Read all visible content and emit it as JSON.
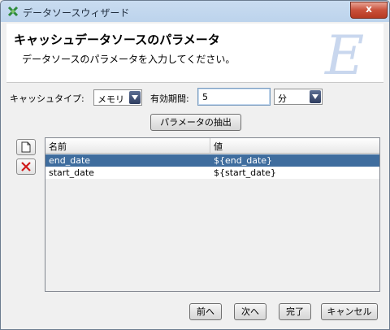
{
  "window": {
    "title": "データソースウィザード",
    "close_glyph": "x"
  },
  "header": {
    "title": "キャッシュデータソースのパラメータ",
    "description": "データソースのパラメータを入力してください。",
    "logo_letter": "E"
  },
  "cache": {
    "type_label": "キャッシュタイプ:",
    "type_value": "メモリ",
    "period_label": "有効期間:",
    "period_value": "5",
    "unit_value": "分"
  },
  "extract_button": "パラメータの抽出",
  "side_buttons": {
    "new_icon": "new-document-icon",
    "delete_icon": "delete-x-icon"
  },
  "table": {
    "columns": [
      "名前",
      "値"
    ],
    "rows": [
      {
        "name": "end_date",
        "value": "${end_date}",
        "selected": true
      },
      {
        "name": "start_date",
        "value": "${start_date}",
        "selected": false
      }
    ]
  },
  "footer": {
    "back": "前へ",
    "next": "次へ",
    "finish": "完了",
    "cancel": "キャンセル"
  },
  "colors": {
    "selection": "#3f6d9e",
    "close_button": "#c9503a"
  }
}
